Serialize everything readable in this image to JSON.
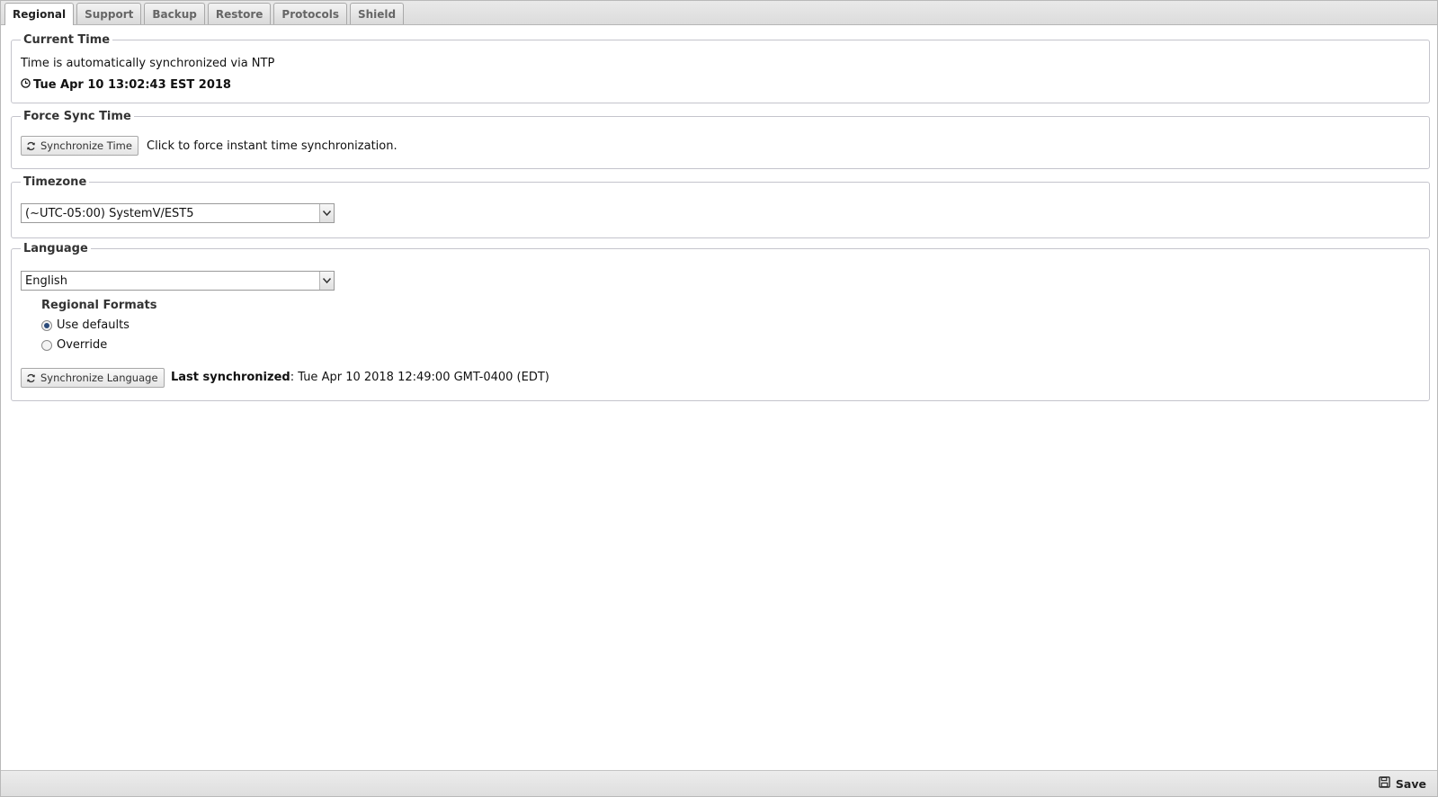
{
  "tabs": [
    "Regional",
    "Support",
    "Backup",
    "Restore",
    "Protocols",
    "Shield"
  ],
  "current_time": {
    "legend": "Current Time",
    "sync_note": "Time is automatically synchronized via NTP",
    "datetime": "Tue Apr 10 13:02:43 EST 2018",
    "icon": "clock-icon"
  },
  "force_sync": {
    "legend": "Force Sync Time",
    "button_label": "Synchronize Time",
    "description": "Click to force instant time synchronization.",
    "icon": "refresh-icon"
  },
  "timezone": {
    "legend": "Timezone",
    "selected": "(~UTC-05:00) SystemV/EST5"
  },
  "language": {
    "legend": "Language",
    "selected": "English",
    "regional_formats_heading": "Regional Formats",
    "options": [
      "Use defaults",
      "Override"
    ],
    "checked_option": "Use defaults",
    "sync_button_label": "Synchronize Language",
    "last_sync_label": "Last synchronized",
    "last_sync_value": ": Tue Apr 10 2018 12:49:00 GMT-0400 (EDT)"
  },
  "footer": {
    "save_label": "Save",
    "icon": "floppy-disk-icon"
  },
  "colors": {
    "active_radio": "#2a4a7a",
    "border": "#c4c4cc",
    "tabbar_bg": "#dcdcdc"
  }
}
